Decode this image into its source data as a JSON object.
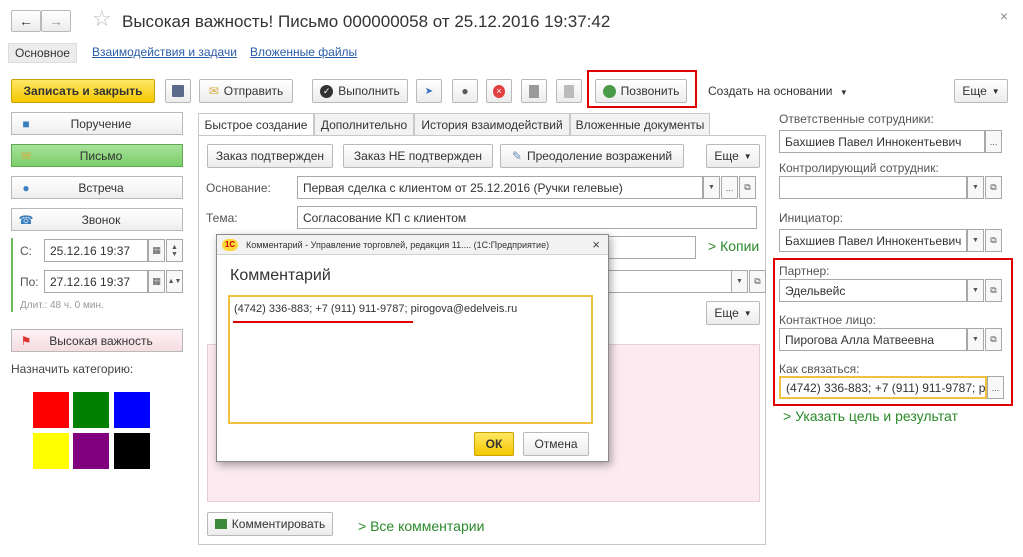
{
  "window": {
    "title": "Высокая важность! Письмо 000000058 от 25.12.2016 19:37:42"
  },
  "nav": {
    "main": "Основное",
    "interactions": "Взаимодействия и задачи",
    "attachments": "Вложенные файлы"
  },
  "toolbar": {
    "save_close": "Записать и закрыть",
    "send": "Отправить",
    "execute": "Выполнить",
    "call": "Позвонить",
    "create_based": "Создать на основании",
    "more": "Еще"
  },
  "left": {
    "task": "Поручение",
    "letter": "Письмо",
    "meeting": "Встреча",
    "call": "Звонок",
    "from_label": "С:",
    "from_value": "25.12.16 19:37",
    "to_label": "По:",
    "to_value": "27.12.16 19:37",
    "duration": "Длит.: 48 ч. 0 мин.",
    "high_importance": "Высокая важность",
    "category_label": "Назначить категорию:",
    "swatches": [
      "#ff0000",
      "#008000",
      "#0000ff",
      "#ffff00",
      "#800080",
      "#000000"
    ]
  },
  "tabs": {
    "quick": "Быстрое создание",
    "extra": "Дополнительно",
    "history": "История взаимодействий",
    "attached_docs": "Вложенные документы"
  },
  "center": {
    "order_confirmed": "Заказ подтвержден",
    "order_not_confirmed": "Заказ НЕ подтвержден",
    "objections": "Преодоление возражений",
    "more": "Еще",
    "basis_label": "Основание:",
    "basis_value": "Первая сделка с клиентом  от 25.12.2016 (Ручки гелевые)",
    "subject_label": "Тема:",
    "subject_value": "Согласование КП с клиентом",
    "copies": "> Копии",
    "more2": "Еще",
    "comment_button": "Комментировать",
    "all_comments": "> Все комментарии"
  },
  "right": {
    "responsible_label": "Ответственные сотрудники:",
    "responsible_value": "Бахшиев Павел Иннокентьевич",
    "controller_label": "Контролирующий сотрудник:",
    "controller_value": "",
    "initiator_label": "Инициатор:",
    "initiator_value": "Бахшиев Павел Иннокентьевич",
    "partner_label": "Партнер:",
    "partner_value": "Эдельвейс",
    "contact_label": "Контактное лицо:",
    "contact_value": "Пирогова Алла Матвеевна",
    "how_contact_label": "Как связаться:",
    "how_contact_value": "(4742) 336-883; +7 (911) 911-9787; pirogova@edelveis.ru",
    "goal_link": "> Указать цель и результат"
  },
  "dialog": {
    "title": "Комментарий - Управление торговлей, редакция 11.... (1С:Предприятие)",
    "heading": "Комментарий",
    "text": "(4742) 336-883; +7 (911) 911-9787; pirogova@edelveis.ru",
    "ok": "ОК",
    "cancel": "Отмена"
  },
  "colors": {
    "accent_yellow": "#ffd83a",
    "green_button": "#88d47a",
    "highlight_red": "#e00000",
    "link_blue": "#2a5ca8",
    "link_green": "#2a8a2a"
  }
}
